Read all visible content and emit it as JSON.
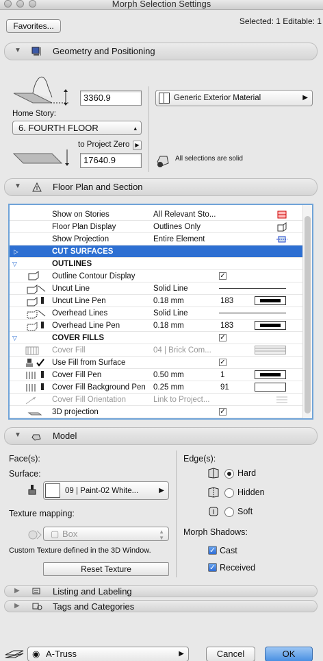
{
  "window": {
    "title": "Morph Selection Settings"
  },
  "toolbar": {
    "favorites_label": "Favorites...",
    "selection_info": "Selected: 1 Editable: 1"
  },
  "geometry": {
    "header": "Geometry and Positioning",
    "top_value": "3360.9",
    "home_story_label": "Home Story:",
    "home_story_value": "6. FOURTH FLOOR",
    "to_project_zero_label": "to Project Zero",
    "bottom_value": "17640.9",
    "material": "Generic Exterior Material",
    "solid_note": "All selections are solid"
  },
  "floor_plan": {
    "header": "Floor Plan and Section",
    "rows": [
      {
        "name": "Show on Stories",
        "value": "All Relevant Sto..."
      },
      {
        "name": "Floor Plan Display",
        "value": "Outlines Only"
      },
      {
        "name": "Show Projection",
        "value": "Entire Element"
      },
      {
        "name": "CUT SURFACES",
        "value": ""
      },
      {
        "name": "OUTLINES",
        "value": ""
      },
      {
        "name": "Outline Contour Display",
        "value": ""
      },
      {
        "name": "Uncut Line",
        "value": "Solid Line"
      },
      {
        "name": "Uncut Line Pen",
        "value": "0.18 mm",
        "num": "183"
      },
      {
        "name": "Overhead Lines",
        "value": "Solid Line"
      },
      {
        "name": "Overhead Line Pen",
        "value": "0.18 mm",
        "num": "183"
      },
      {
        "name": "COVER FILLS",
        "value": ""
      },
      {
        "name": "Cover Fill",
        "value": "04 | Brick Com..."
      },
      {
        "name": "Use Fill from Surface",
        "value": ""
      },
      {
        "name": "Cover Fill Pen",
        "value": "0.50 mm",
        "num": "1"
      },
      {
        "name": "Cover Fill Background Pen",
        "value": "0.25 mm",
        "num": "91"
      },
      {
        "name": "Cover Fill Orientation",
        "value": "Link to Project..."
      },
      {
        "name": "3D projection",
        "value": ""
      }
    ],
    "check_mark": "✓"
  },
  "model": {
    "header": "Model",
    "faces_label": "Face(s):",
    "surface_label": "Surface:",
    "surface_value": "09 | Paint-02 White...",
    "texture_mapping_label": "Texture mapping:",
    "texture_mapping_value": "Box",
    "custom_texture_note": "Custom Texture defined in the 3D Window.",
    "reset_texture_label": "Reset Texture",
    "edges_label": "Edge(s):",
    "edge_hard": "Hard",
    "edge_hidden": "Hidden",
    "edge_soft": "Soft",
    "shadows_label": "Morph Shadows:",
    "shadow_cast": "Cast",
    "shadow_received": "Received"
  },
  "listing": {
    "header": "Listing and Labeling"
  },
  "tags": {
    "header": "Tags and Categories"
  },
  "footer": {
    "layer_value": "A-Truss",
    "cancel_label": "Cancel",
    "ok_label": "OK"
  },
  "colors": {
    "selection": "#2d6fd2",
    "ok_button": "#4a90e2",
    "list_border": "#6fa3d8"
  }
}
